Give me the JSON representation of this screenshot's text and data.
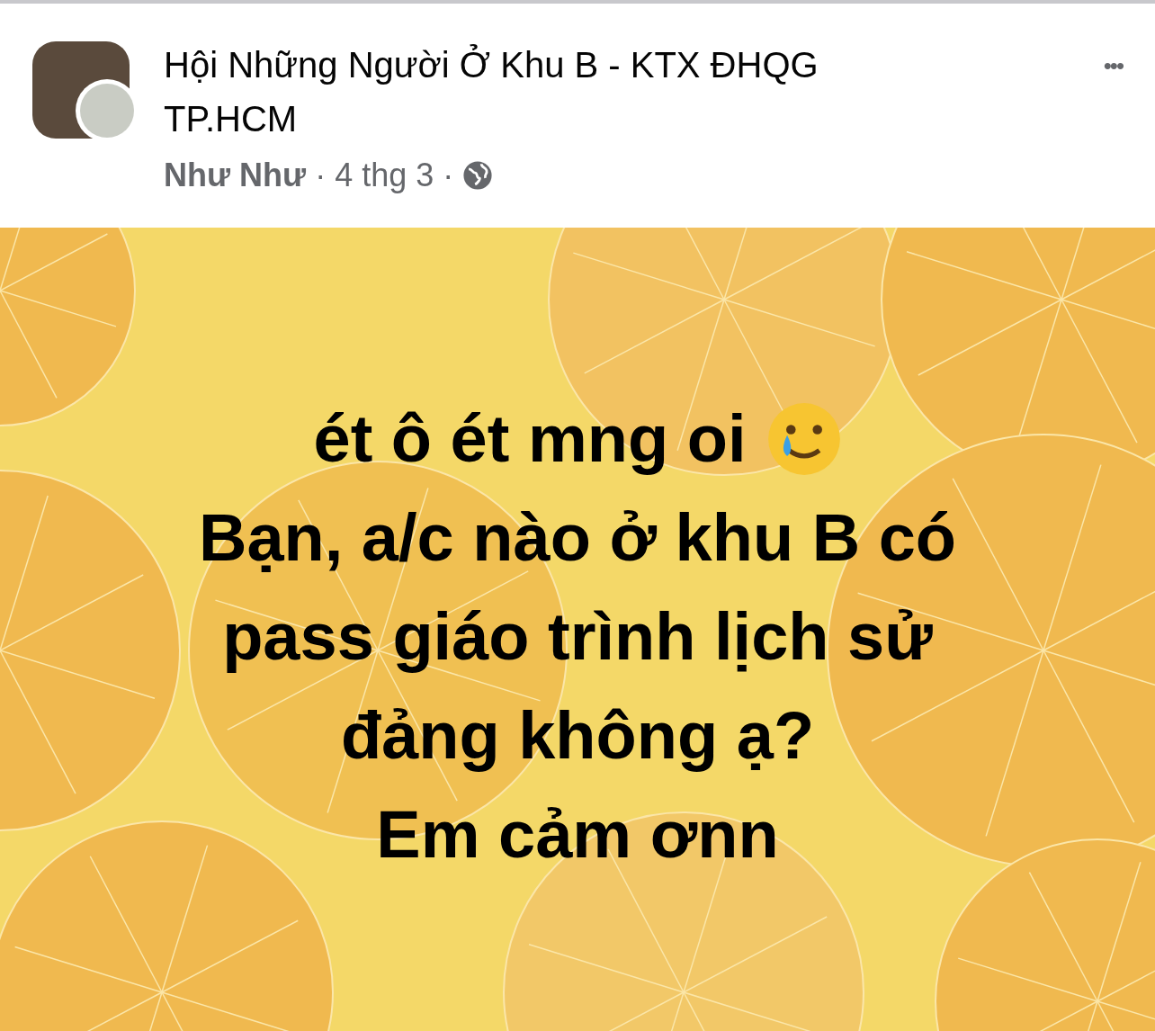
{
  "post": {
    "group_name": "Hội Những Người Ở Khu B - KTX ĐHQG TP.HCM",
    "author": "Như Như",
    "separator": "·",
    "time": "4 thg 3",
    "more": "•••",
    "body_lines": [
      "ét ô ét mng oi",
      "Bạn, a/c nào ở khu B có",
      "pass giáo trình lịch sử",
      "đảng không ạ?",
      "Em cảm ơnn"
    ]
  }
}
